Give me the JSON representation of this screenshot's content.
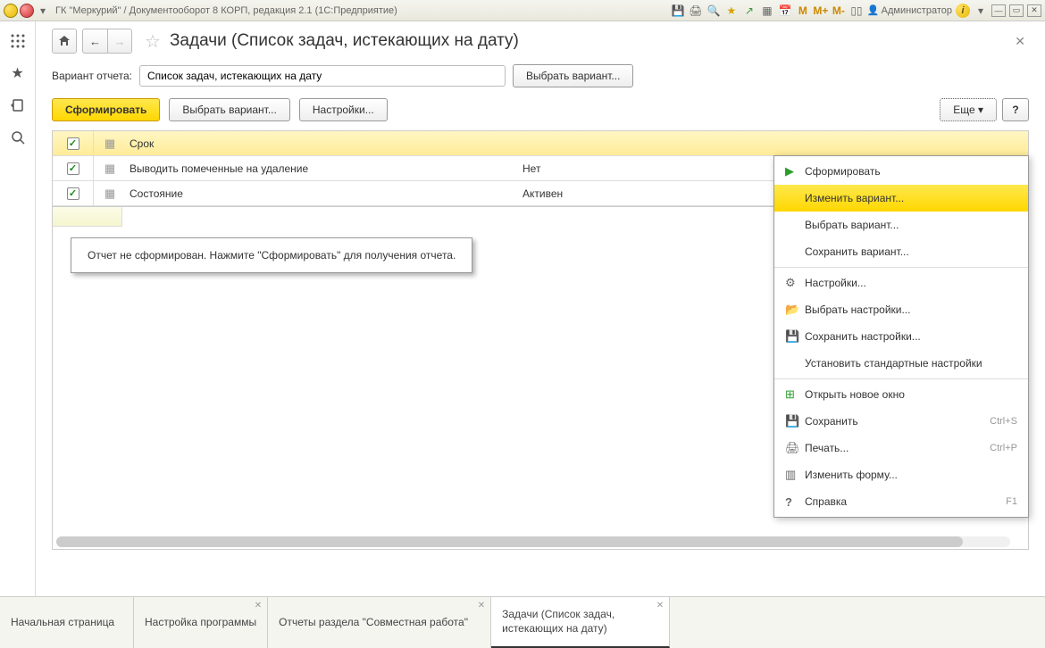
{
  "titlebar": {
    "text": "ГК \"Меркурий\" / Документооборот 8 КОРП, редакция 2.1  (1С:Предприятие)",
    "user": "Администратор"
  },
  "page": {
    "title": "Задачи (Список задач, истекающих на дату)"
  },
  "variant": {
    "label": "Вариант отчета:",
    "value": "Список задач, истекающих на дату",
    "choose_btn": "Выбрать вариант..."
  },
  "toolbar": {
    "generate": "Сформировать",
    "choose_variant": "Выбрать вариант...",
    "settings": "Настройки...",
    "more": "Еще",
    "help": "?"
  },
  "params": [
    {
      "name": "Срок",
      "value": "",
      "active": true
    },
    {
      "name": "Выводить помеченные на удаление",
      "value": "Нет",
      "active": false
    },
    {
      "name": "Состояние",
      "value": "Активен",
      "active": false
    }
  ],
  "report": {
    "message": "Отчет не сформирован. Нажмите \"Сформировать\" для получения отчета."
  },
  "menu": {
    "items": [
      {
        "icon": "play",
        "label": "Сформировать",
        "highlighted": false
      },
      {
        "icon": "",
        "label": "Изменить вариант...",
        "highlighted": true
      },
      {
        "icon": "",
        "label": "Выбрать вариант...",
        "highlighted": false
      },
      {
        "icon": "",
        "label": "Сохранить вариант...",
        "highlighted": false
      },
      {
        "sep": true
      },
      {
        "icon": "gear",
        "label": "Настройки...",
        "highlighted": false
      },
      {
        "icon": "folder",
        "label": "Выбрать настройки...",
        "highlighted": false
      },
      {
        "icon": "save-settings",
        "label": "Сохранить настройки...",
        "highlighted": false
      },
      {
        "icon": "",
        "label": "Установить стандартные настройки",
        "highlighted": false
      },
      {
        "sep": true
      },
      {
        "icon": "new-window",
        "label": "Открыть новое окно",
        "highlighted": false
      },
      {
        "icon": "save",
        "label": "Сохранить",
        "shortcut": "Ctrl+S",
        "highlighted": false
      },
      {
        "icon": "print",
        "label": "Печать...",
        "shortcut": "Ctrl+P",
        "highlighted": false
      },
      {
        "icon": "form",
        "label": "Изменить форму...",
        "highlighted": false
      },
      {
        "icon": "help",
        "label": "Справка",
        "shortcut": "F1",
        "highlighted": false
      }
    ]
  },
  "tabs": [
    {
      "label": "Начальная страница",
      "closable": false,
      "active": false
    },
    {
      "label": "Настройка программы",
      "closable": true,
      "active": false
    },
    {
      "label": "Отчеты раздела \"Совместная работа\"",
      "closable": true,
      "active": false,
      "wide": true
    },
    {
      "label": "Задачи (Список задач, истекающих на дату)",
      "closable": true,
      "active": true
    }
  ]
}
